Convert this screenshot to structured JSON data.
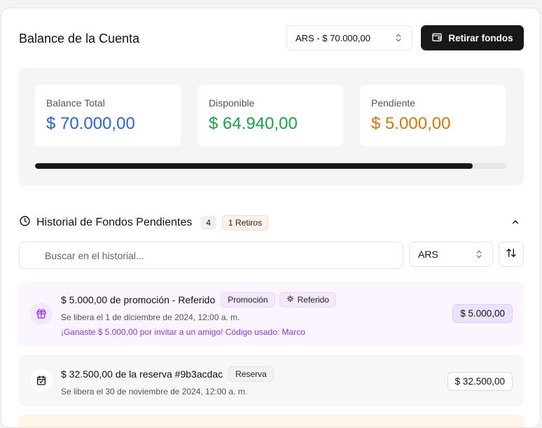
{
  "header": {
    "title": "Balance de la Cuenta",
    "currency_select": "ARS - $ 70.000,00",
    "withdraw_label": "Retirar fondos"
  },
  "balance": {
    "total": {
      "label": "Balance Total",
      "value": "$ 70.000,00",
      "color": "#2563eb"
    },
    "available": {
      "label": "Disponible",
      "value": "$ 64.940,00",
      "color": "#16a34a"
    },
    "pending": {
      "label": "Pendiente",
      "value": "$ 5.000,00",
      "color": "#d97706"
    },
    "progress_fraction": 0.928
  },
  "history": {
    "title": "Historial de Fondos Pendientes",
    "count": "4",
    "withdrawals_badge": "1 Retiros",
    "search_placeholder": "Buscar en el historial...",
    "currency_filter": "ARS",
    "items": [
      {
        "title": "$ 5.000,00 de promoción - Referido",
        "tags": [
          "Promoción",
          "Referido"
        ],
        "date": "Se libera el 1 de diciembre de 2024, 12:00 a. m.",
        "note": "¡Ganaste $ 5.000,00 por invitar a un amigo! Código usado: Marco",
        "amount": "$ 5.000,00",
        "icon": "gift-icon"
      },
      {
        "title": "$ 32.500,00 de la reserva #9b3acdac",
        "tags": [
          "Reserva"
        ],
        "date": "Se libera el 30 de noviembre de 2024, 12:00 a. m.",
        "amount": "$ 32.500,00",
        "icon": "calendar-check-icon"
      }
    ]
  }
}
